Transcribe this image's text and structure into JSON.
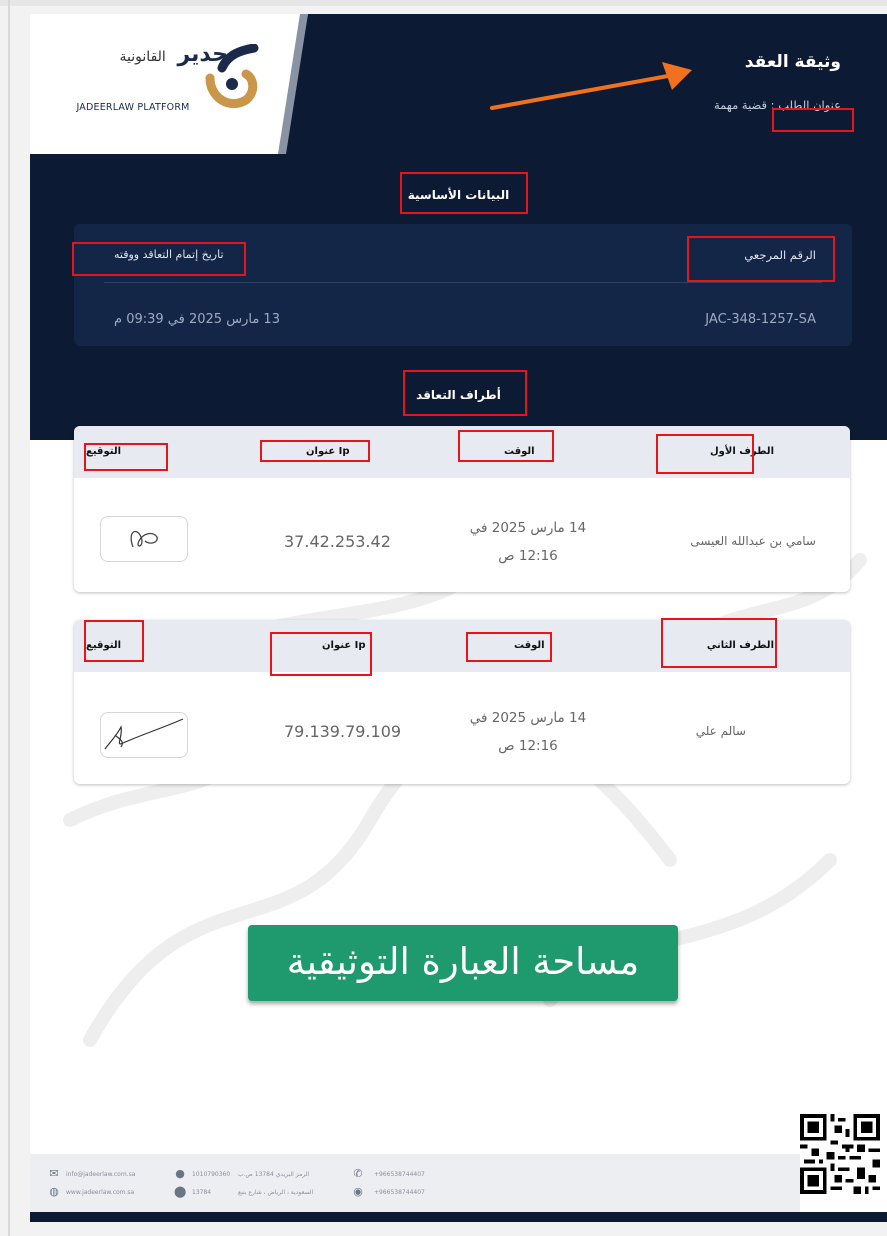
{
  "logo": {
    "name_ar": "جدير",
    "name_ar_sub": "القانونية",
    "name_en": "JADEERLAW PLATFORM"
  },
  "header": {
    "doc_title": "وثيقة العقد",
    "request_title": "عنوان الطلب : قضية مهمة"
  },
  "basic": {
    "section_title": "البيانات الأساسية",
    "ref_label": "الرقم المرجعي",
    "date_label": "تاريخ إتمام التعاقد ووقته",
    "ref_value": "JAC-348-1257-SA",
    "date_value": "13 مارس 2025 في 09:39 م"
  },
  "parties": {
    "section_title": "أطراف التعاقد",
    "col_signature": "التوقيع",
    "col_ip": "Ip عنوان",
    "col_time": "الوقت",
    "first": {
      "col_party": "الطرف الأول",
      "name": "سامي بن عبدالله العيسى",
      "time_line1": "14 مارس 2025 في",
      "time_line2": "12:16 ص",
      "ip": "37.42.253.42"
    },
    "second": {
      "col_party": "الطرف الثاني",
      "name": "سالم علي",
      "time_line1": "14 مارس 2025 في",
      "time_line2": "12:16 ص",
      "ip": "79.139.79.109"
    }
  },
  "stamp_text": "مساحة العبارة التوثيقية",
  "footer": {
    "email": "info@jadeerlaw.com.sa",
    "website": "www.jadeerlaw.com.sa",
    "cr": "1010790360",
    "postal": "الرمز البريدي 13784 ص.ب",
    "address_code": "13784",
    "address": "السعودية ، الرياض ، شارع بنبع",
    "phone": "+966538744407",
    "whatsapp": "+966538744407"
  },
  "colors": {
    "navy": "#0c1a33",
    "card": "#142647",
    "highlight": "#e8141b",
    "arrow": "#f2711c",
    "stamp": "#1f9a6f",
    "logo_gold": "#c9964a"
  }
}
